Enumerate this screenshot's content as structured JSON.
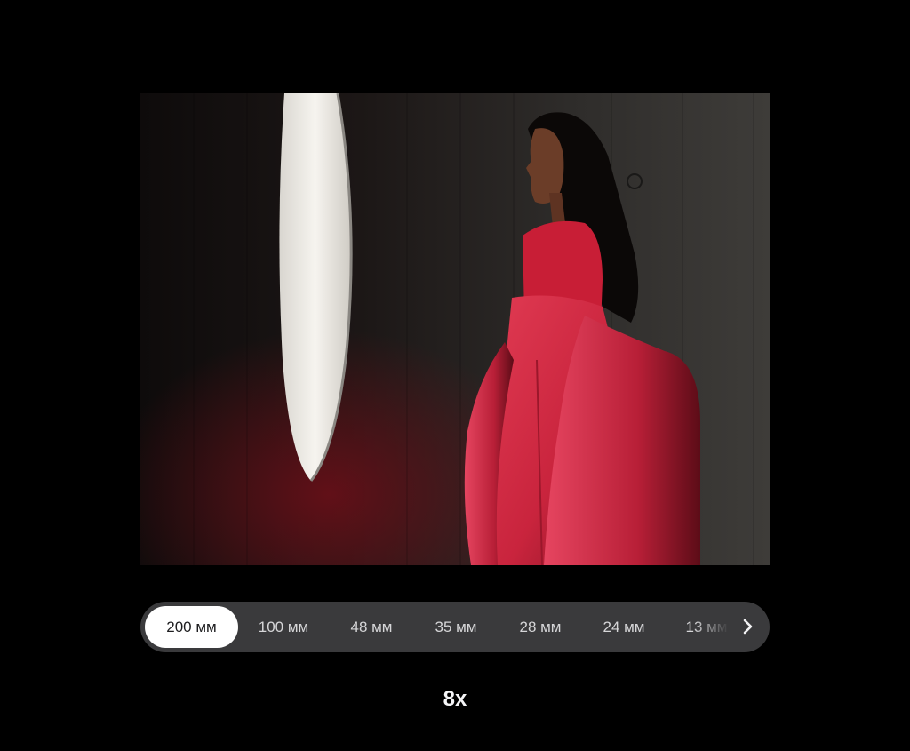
{
  "viewer": {
    "photo": {
      "icon": "portrait-photo",
      "colors": {
        "dress": "#d62b45",
        "wall": "#2a2826",
        "window_light": "#f2f0ec"
      }
    },
    "lens_options": [
      {
        "label": "200 мм",
        "selected": true
      },
      {
        "label": "100 мм",
        "selected": false
      },
      {
        "label": "48 мм",
        "selected": false
      },
      {
        "label": "35 мм",
        "selected": false
      },
      {
        "label": "28 мм",
        "selected": false
      },
      {
        "label": "24 мм",
        "selected": false
      },
      {
        "label": "13 мм",
        "selected": false
      }
    ],
    "next_icon": "chevron-right-icon",
    "zoom_label": "8x"
  }
}
